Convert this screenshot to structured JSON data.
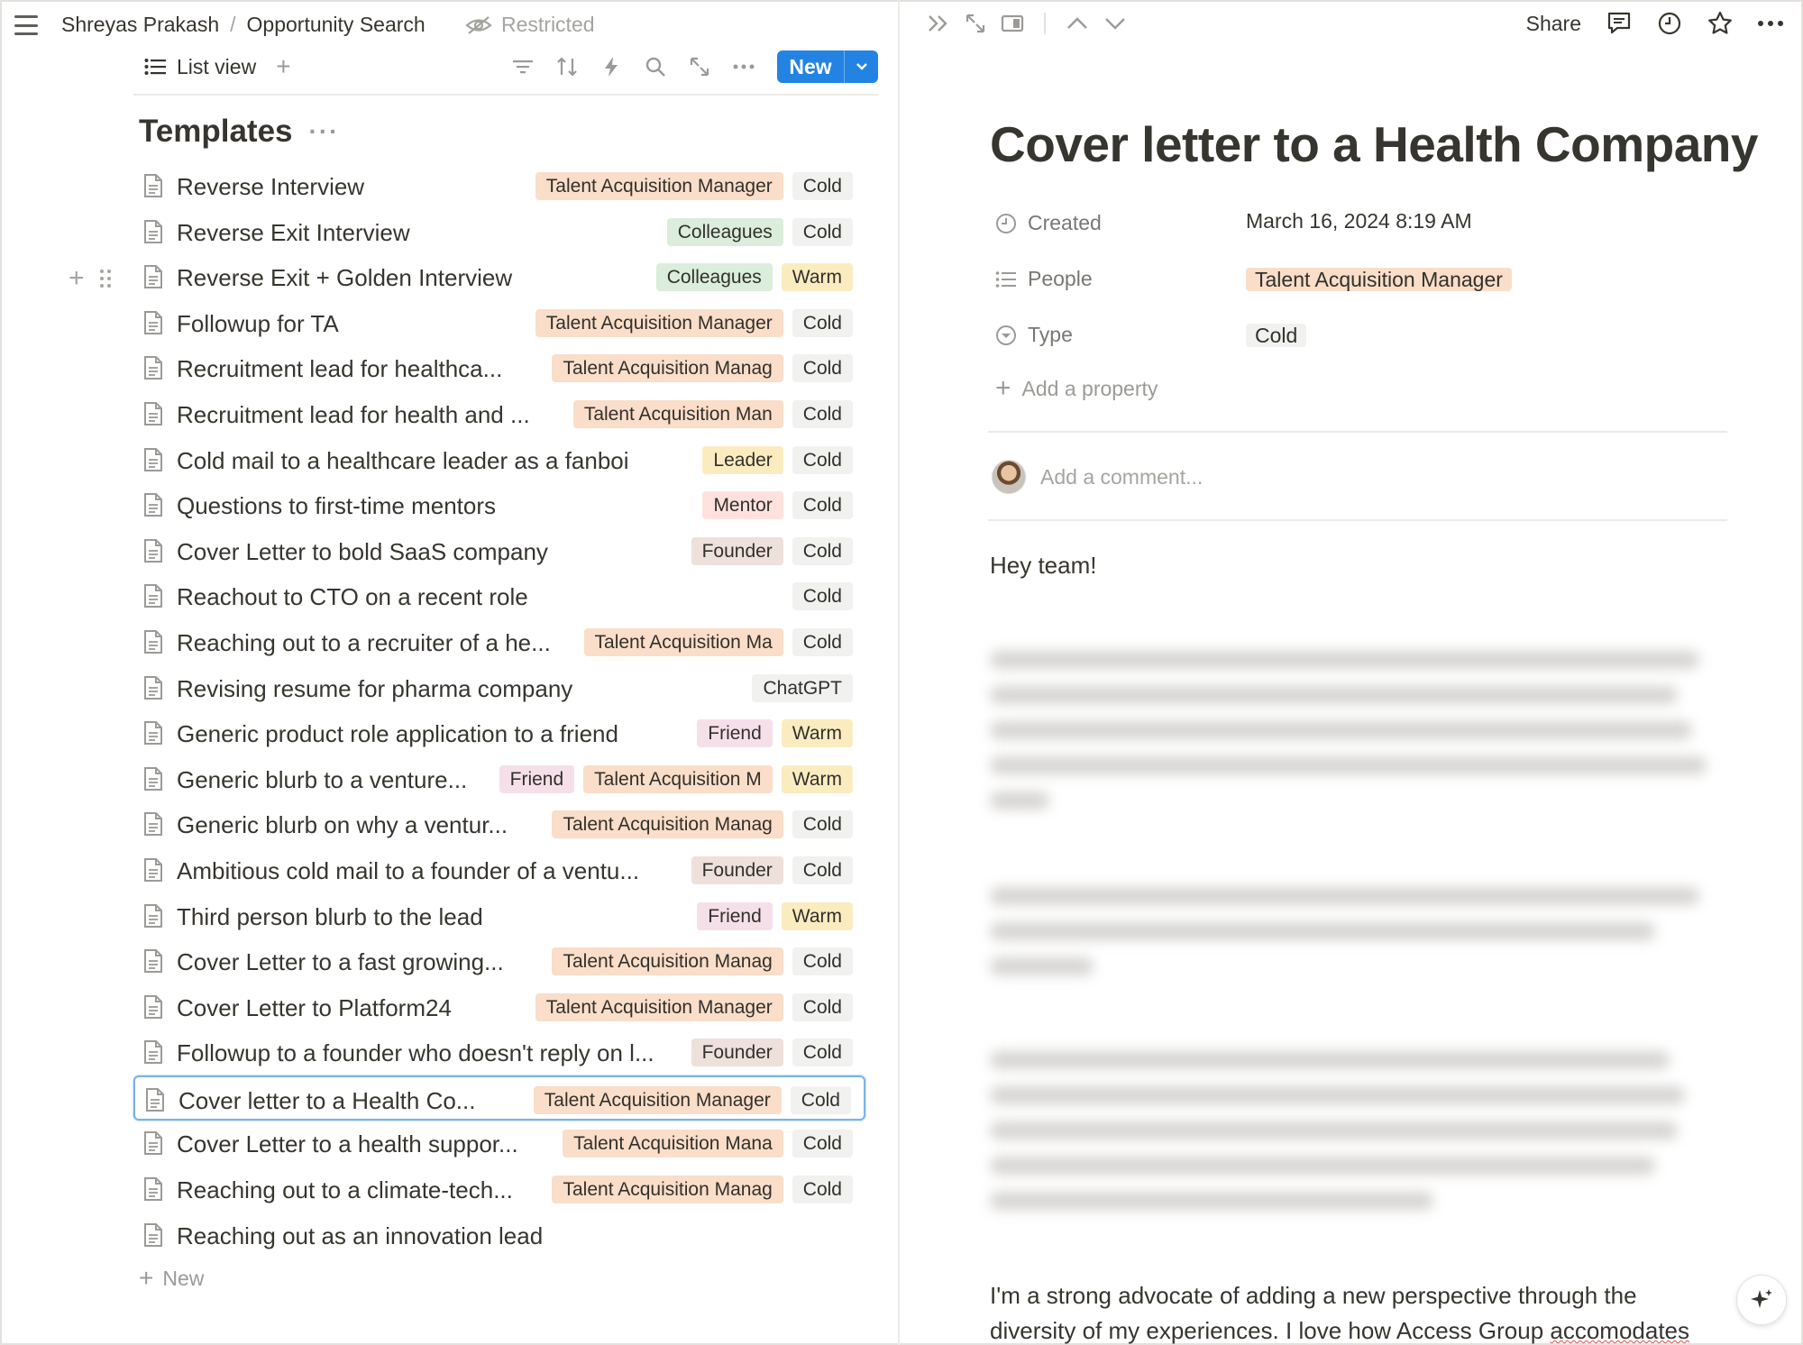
{
  "breadcrumb": {
    "workspace": "Shreyas Prakash",
    "page": "Opportunity Search",
    "restricted": "Restricted"
  },
  "toolbar": {
    "view_label": "List view",
    "new_label": "New"
  },
  "templates": {
    "heading": "Templates",
    "add_label": "New",
    "items": [
      {
        "title": "Reverse Interview",
        "tags": [
          {
            "label": "Talent Acquisition Manager",
            "color": "orange"
          },
          {
            "label": "Cold",
            "color": "gray"
          }
        ]
      },
      {
        "title": "Reverse Exit Interview",
        "tags": [
          {
            "label": "Colleagues",
            "color": "green"
          },
          {
            "label": "Cold",
            "color": "gray"
          }
        ]
      },
      {
        "title": "Reverse Exit + Golden Interview",
        "tags": [
          {
            "label": "Colleagues",
            "color": "green"
          },
          {
            "label": "Warm",
            "color": "yellow"
          }
        ]
      },
      {
        "title": "Followup for TA",
        "tags": [
          {
            "label": "Talent Acquisition Manager",
            "color": "orange"
          },
          {
            "label": "Cold",
            "color": "gray"
          }
        ]
      },
      {
        "title": "Recruitment lead for healthca...",
        "tags": [
          {
            "label": "Talent Acquisition Manag",
            "color": "orange"
          },
          {
            "label": "Cold",
            "color": "gray"
          }
        ]
      },
      {
        "title": "Recruitment lead for health and ...",
        "tags": [
          {
            "label": "Talent Acquisition Man",
            "color": "orange"
          },
          {
            "label": "Cold",
            "color": "gray"
          }
        ]
      },
      {
        "title": "Cold mail to a healthcare leader as a fanboi",
        "tags": [
          {
            "label": "Leader",
            "color": "yellow"
          },
          {
            "label": "Cold",
            "color": "gray"
          }
        ]
      },
      {
        "title": "Questions to first-time mentors",
        "tags": [
          {
            "label": "Mentor",
            "color": "red"
          },
          {
            "label": "Cold",
            "color": "gray"
          }
        ]
      },
      {
        "title": "Cover Letter to bold SaaS company",
        "tags": [
          {
            "label": "Founder",
            "color": "brown"
          },
          {
            "label": "Cold",
            "color": "gray"
          }
        ]
      },
      {
        "title": "Reachout to CTO on a recent role",
        "tags": [
          {
            "label": "Cold",
            "color": "gray"
          }
        ]
      },
      {
        "title": "Reaching out to a recruiter of a he...",
        "tags": [
          {
            "label": "Talent Acquisition Ma",
            "color": "orange"
          },
          {
            "label": "Cold",
            "color": "gray"
          }
        ]
      },
      {
        "title": "Revising resume for pharma company",
        "tags": [
          {
            "label": "ChatGPT",
            "color": "gray"
          }
        ]
      },
      {
        "title": "Generic product role application to a friend",
        "tags": [
          {
            "label": "Friend",
            "color": "pink"
          },
          {
            "label": "Warm",
            "color": "yellow"
          }
        ]
      },
      {
        "title": "Generic blurb to a venture...",
        "tags": [
          {
            "label": "Friend",
            "color": "pink"
          },
          {
            "label": "Talent Acquisition M",
            "color": "orange"
          },
          {
            "label": "Warm",
            "color": "yellow"
          }
        ]
      },
      {
        "title": "Generic blurb on why a ventur...",
        "tags": [
          {
            "label": "Talent Acquisition Manag",
            "color": "orange"
          },
          {
            "label": "Cold",
            "color": "gray"
          }
        ]
      },
      {
        "title": "Ambitious cold mail to a founder of a ventu...",
        "tags": [
          {
            "label": "Founder",
            "color": "brown"
          },
          {
            "label": "Cold",
            "color": "gray"
          }
        ]
      },
      {
        "title": "Third person blurb to the lead",
        "tags": [
          {
            "label": "Friend",
            "color": "pink"
          },
          {
            "label": "Warm",
            "color": "yellow"
          }
        ]
      },
      {
        "title": "Cover Letter to a fast growing...",
        "tags": [
          {
            "label": "Talent Acquisition Manag",
            "color": "orange"
          },
          {
            "label": "Cold",
            "color": "gray"
          }
        ]
      },
      {
        "title": "Cover Letter to Platform24",
        "tags": [
          {
            "label": "Talent Acquisition Manager",
            "color": "orange"
          },
          {
            "label": "Cold",
            "color": "gray"
          }
        ]
      },
      {
        "title": "Followup to a founder who doesn't reply on l...",
        "tags": [
          {
            "label": "Founder",
            "color": "brown"
          },
          {
            "label": "Cold",
            "color": "gray"
          }
        ]
      },
      {
        "title": "Cover letter to a Health Co...",
        "selected": true,
        "tags": [
          {
            "label": "Talent Acquisition Manager",
            "color": "orange"
          },
          {
            "label": "Cold",
            "color": "gray"
          }
        ]
      },
      {
        "title": "Cover Letter to a health suppor...",
        "tags": [
          {
            "label": "Talent Acquisition Mana",
            "color": "orange"
          },
          {
            "label": "Cold",
            "color": "gray"
          }
        ]
      },
      {
        "title": "Reaching out to a climate-tech...",
        "tags": [
          {
            "label": "Talent Acquisition Manag",
            "color": "orange"
          },
          {
            "label": "Cold",
            "color": "gray"
          }
        ]
      },
      {
        "title": "Reaching out as an innovation lead",
        "tags": []
      }
    ]
  },
  "detail": {
    "share_label": "Share",
    "title": "Cover letter to a Health Company",
    "properties": {
      "created_label": "Created",
      "created_value": "March 16, 2024 8:19 AM",
      "people_label": "People",
      "people_value": "Talent Acquisition Manager",
      "type_label": "Type",
      "type_value": "Cold"
    },
    "add_property": "Add a property",
    "comment_placeholder": "Add a comment...",
    "greeting": "Hey team!",
    "paragraph_a": "I'm a strong advocate of adding a new perspective through the",
    "paragraph_b": "diversity of my experiences. I love how Access Group ",
    "paragraph_c": "accomodates"
  },
  "colors": {
    "accent": "#2383e2",
    "orange": "#fadec9",
    "green": "#dbeddb",
    "yellow": "#fbecc0",
    "gray": "#f1f1ef",
    "red": "#ffe2dd",
    "pink": "#f5e0e9",
    "brown": "#eee0da"
  }
}
